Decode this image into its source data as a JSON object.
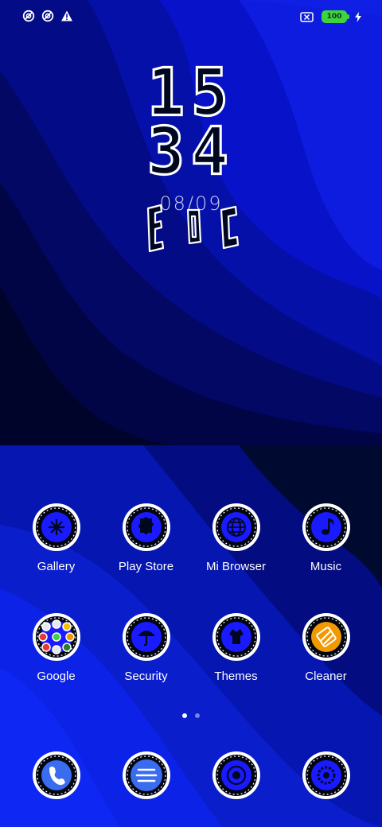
{
  "status_bar": {
    "left_icons": [
      "data-saver-icon",
      "data-saver-icon",
      "warning-icon"
    ],
    "right_icons": [
      "no-sim-icon",
      "battery-icon",
      "charging-icon"
    ],
    "battery_level": "100"
  },
  "lockscreen": {
    "hour": "15",
    "minute": "34",
    "date": "08/09"
  },
  "apps": [
    {
      "label": "Gallery",
      "icon": "gallery-icon"
    },
    {
      "label": "Play Store",
      "icon": "play-store-icon"
    },
    {
      "label": "Mi Browser",
      "icon": "globe-icon"
    },
    {
      "label": "Music",
      "icon": "music-icon"
    },
    {
      "label": "Google",
      "icon": "google-folder-icon"
    },
    {
      "label": "Security",
      "icon": "umbrella-icon"
    },
    {
      "label": "Themes",
      "icon": "themes-icon"
    },
    {
      "label": "Cleaner",
      "icon": "cleaner-icon"
    }
  ],
  "page_indicator": {
    "pages": 2,
    "current": 1
  },
  "dock": [
    {
      "icon": "phone-icon"
    },
    {
      "icon": "messages-icon"
    },
    {
      "icon": "camera-icon"
    },
    {
      "icon": "settings-icon"
    }
  ],
  "colors": {
    "accent": "#1a1aff",
    "dark_bg": "#000a2a",
    "battery": "#3ed43e"
  }
}
